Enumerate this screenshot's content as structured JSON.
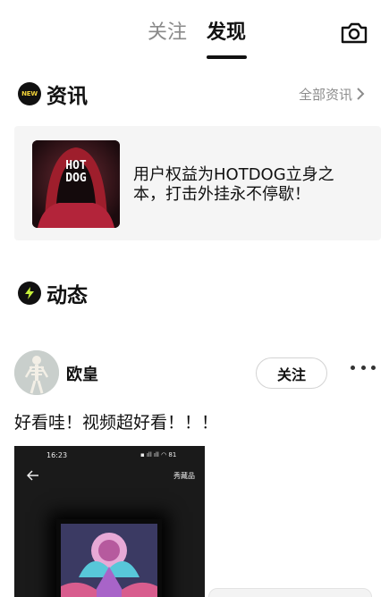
{
  "tabs": {
    "follow": "关注",
    "discover": "发现"
  },
  "news": {
    "badge": "NEW",
    "title": "资讯",
    "more": "全部资讯",
    "card": {
      "text": "用户权益为HOTDOG立身之本，打击外挂永不停歇！",
      "thumb_text_line1": "HOT",
      "thumb_text_line2": "DOG"
    }
  },
  "feed": {
    "title": "动态"
  },
  "post": {
    "username": "欧皇",
    "follow_label": "关注",
    "text": "好看哇！视频超好看！！！",
    "image": {
      "status_time": "16:23",
      "status_icons": "▪ ıll ıll ◠ 81",
      "label": "秀藏品"
    }
  },
  "colors": {
    "accent": "#111111",
    "muted": "#8a8a8a",
    "card_bg": "#f5f5f5",
    "new_badge_text": "#f2d33a"
  }
}
